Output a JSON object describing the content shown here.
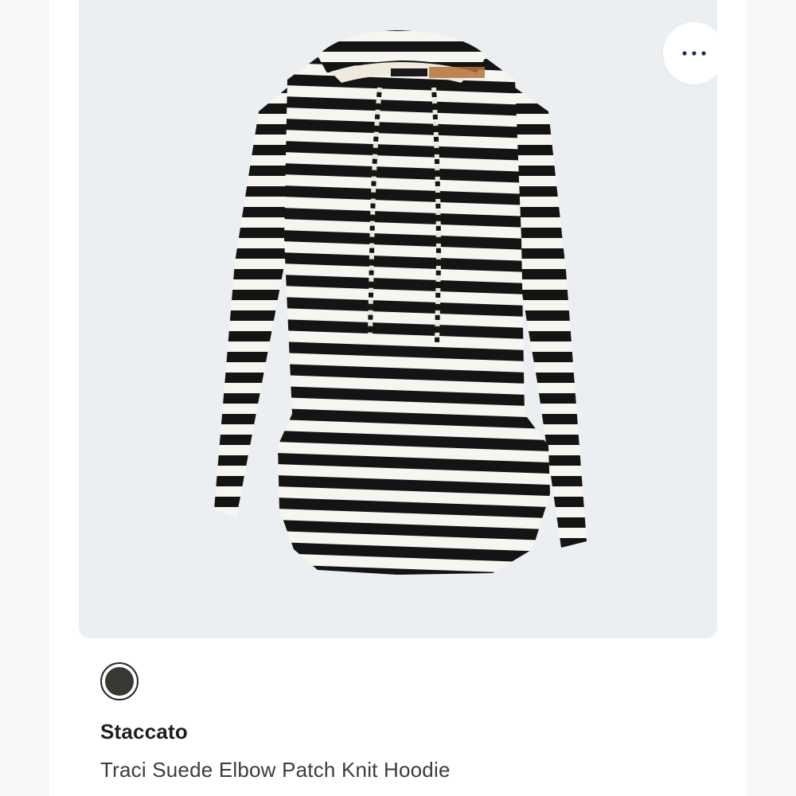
{
  "product": {
    "image_icon": "striped-hoodie-photo",
    "more_options_icon": "ellipsis-icon",
    "accent_color": "#1b2a6b",
    "swatch_color": "#3a3832",
    "brand": "Staccato",
    "title": "Traci Suede Elbow Patch Knit Hoodie"
  }
}
